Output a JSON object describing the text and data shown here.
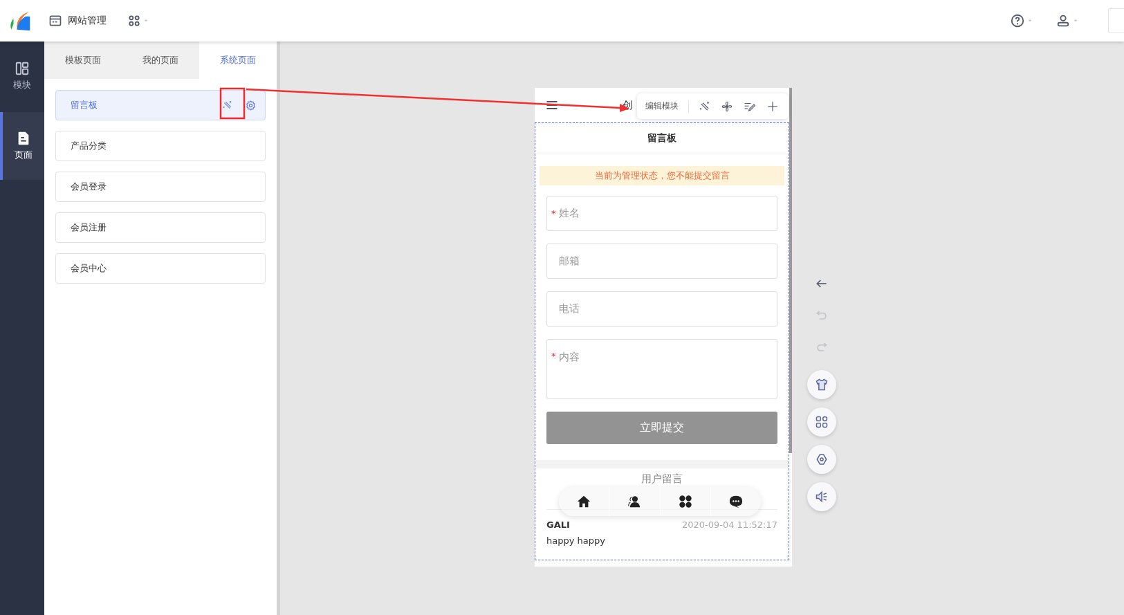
{
  "header": {
    "title": "网站管理"
  },
  "sidebar": {
    "items": [
      {
        "label": "模块",
        "selected": false
      },
      {
        "label": "页面",
        "selected": true
      }
    ]
  },
  "panel": {
    "tabs": [
      {
        "label": "模板页面",
        "selected": false
      },
      {
        "label": "我的页面",
        "selected": false
      },
      {
        "label": "系统页面",
        "selected": true
      }
    ],
    "pages": [
      {
        "label": "留言板",
        "selected": true
      },
      {
        "label": "产品分类",
        "selected": false
      },
      {
        "label": "会员登录",
        "selected": false
      },
      {
        "label": "会员注册",
        "selected": false
      },
      {
        "label": "会员中心",
        "selected": false
      }
    ]
  },
  "phone": {
    "title": "创",
    "required_mark": "*",
    "toolbar": {
      "label": "编辑模块"
    },
    "module_title": "留言板",
    "notice": "当前为管理状态，您不能提交留言",
    "fields": [
      {
        "kind": "input",
        "placeholder": "姓名",
        "required": true
      },
      {
        "kind": "input",
        "placeholder": "邮箱",
        "required": false
      },
      {
        "kind": "input",
        "placeholder": "电话",
        "required": false
      },
      {
        "kind": "textarea",
        "placeholder": "内容",
        "required": true
      }
    ],
    "submit": "立即提交",
    "messages_title": "用户留言",
    "messages": [
      {
        "author": "GALI",
        "time": "2020-09-04 11:52:17",
        "text": "happy happy"
      }
    ]
  },
  "tools": [
    {
      "kind": "plain",
      "disabled": false
    },
    {
      "kind": "plain",
      "disabled": true
    },
    {
      "kind": "plain",
      "disabled": true
    },
    {
      "kind": "round",
      "disabled": false
    },
    {
      "kind": "round",
      "disabled": false
    },
    {
      "kind": "round",
      "disabled": false
    },
    {
      "kind": "round",
      "disabled": false
    }
  ]
}
